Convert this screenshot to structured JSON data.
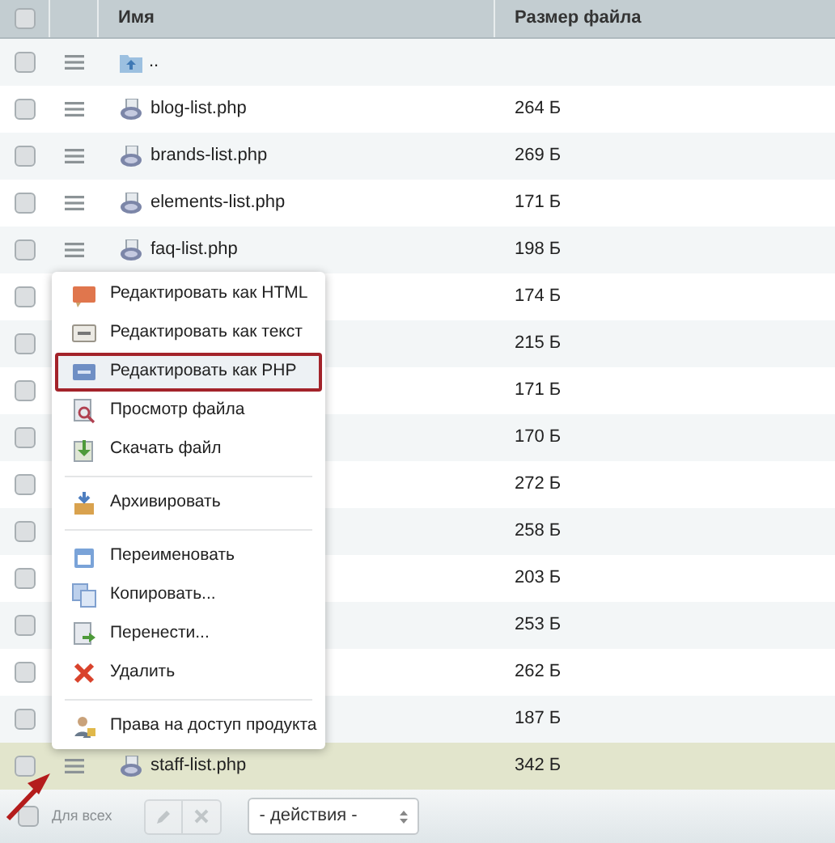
{
  "table": {
    "columns": [
      {
        "kind": "checkbox",
        "checked": false
      },
      {
        "kind": "blank"
      },
      {
        "kind": "label",
        "label": "Имя"
      },
      {
        "kind": "label",
        "label": "Размер файла"
      }
    ],
    "rows": [
      {
        "kind": "folder-up",
        "name": "..",
        "checked": false,
        "selected": false
      },
      {
        "kind": "file",
        "name": "blog-list.php",
        "size": "264 Б",
        "checked": false,
        "selected": false
      },
      {
        "kind": "file",
        "name": "brands-list.php",
        "size": "269 Б",
        "checked": false,
        "selected": false
      },
      {
        "kind": "file",
        "name": "elements-list.php",
        "size": "171 Б",
        "checked": false,
        "selected": false
      },
      {
        "kind": "file",
        "name": "faq-list.php",
        "size": "198 Б",
        "checked": false,
        "selected": false
      },
      {
        "kind": "hidden",
        "size": "174 Б",
        "checked": false,
        "selected": false
      },
      {
        "kind": "hidden",
        "size": "215 Б",
        "checked": false,
        "selected": false
      },
      {
        "kind": "hidden",
        "size": "171 Б",
        "checked": false,
        "selected": false
      },
      {
        "kind": "hidden",
        "size": "170 Б",
        "checked": false,
        "selected": false
      },
      {
        "kind": "hidden",
        "size": "272 Б",
        "checked": false,
        "selected": false
      },
      {
        "kind": "hidden",
        "size": "258 Б",
        "checked": false,
        "selected": false
      },
      {
        "kind": "hidden",
        "size": "203 Б",
        "checked": false,
        "selected": false
      },
      {
        "kind": "hidden",
        "size": "253 Б",
        "checked": false,
        "selected": false
      },
      {
        "kind": "hidden",
        "size": "262 Б",
        "checked": false,
        "selected": false
      },
      {
        "kind": "hidden",
        "size": "187 Б",
        "checked": false,
        "selected": false
      },
      {
        "kind": "file",
        "name": "staff-list.php",
        "size": "342 Б",
        "checked": false,
        "selected": true
      }
    ]
  },
  "context_menu": {
    "items": [
      {
        "kind": "html",
        "label": "Редактировать как HTML",
        "highlighted": false
      },
      {
        "kind": "text",
        "label": "Редактировать как текст",
        "highlighted": false
      },
      {
        "kind": "php",
        "label": "Редактировать как PHP",
        "highlighted": true
      },
      {
        "kind": "view",
        "label": "Просмотр файла",
        "highlighted": false
      },
      {
        "kind": "download",
        "label": "Скачать файл",
        "highlighted": false
      },
      {
        "kind": "separator"
      },
      {
        "kind": "archive",
        "label": "Архивировать",
        "highlighted": false
      },
      {
        "kind": "separator"
      },
      {
        "kind": "rename",
        "label": "Переименовать",
        "highlighted": false
      },
      {
        "kind": "copy",
        "label": "Копировать...",
        "highlighted": false
      },
      {
        "kind": "move",
        "label": "Перенести...",
        "highlighted": false
      },
      {
        "kind": "delete",
        "label": "Удалить",
        "highlighted": false
      },
      {
        "kind": "separator"
      },
      {
        "kind": "access",
        "label": "Права на доступ продукта",
        "highlighted": false
      }
    ]
  },
  "footer": {
    "for_all": {
      "label": "Для всех",
      "checked": false
    },
    "edit_disabled": true,
    "delete_disabled": true,
    "actions_select": {
      "value": "- действия -"
    }
  }
}
